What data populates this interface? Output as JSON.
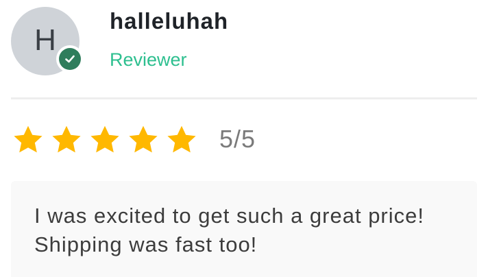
{
  "reviewer": {
    "initial": "H",
    "name": "halleluhah",
    "role": "Reviewer",
    "verified": true,
    "verified_icon": "check-icon",
    "colors": {
      "avatar_bg": "#cfd3d8",
      "verified_bg": "#2f7d5c",
      "role_text": "#2dbf8f"
    }
  },
  "rating": {
    "value": 5,
    "max": 5,
    "label": "5/5",
    "star_color": "#ffb800",
    "star_icon": "star-icon"
  },
  "review": {
    "text": "I was excited to get such a great price! Shipping was fast too!"
  }
}
